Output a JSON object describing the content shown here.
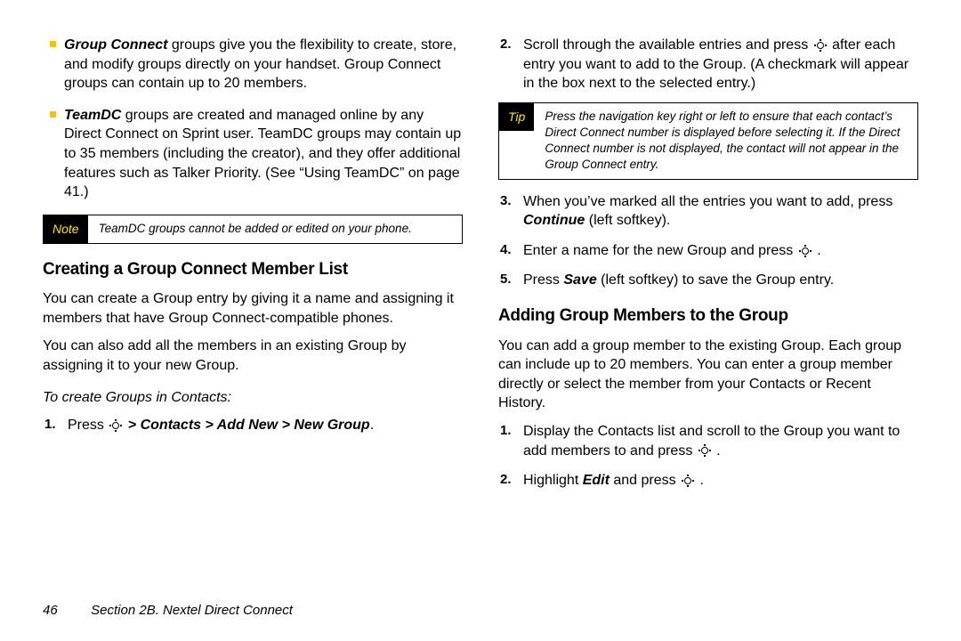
{
  "left": {
    "bullets": [
      {
        "lead": "Group Connect",
        "rest": " groups give you the flexibility to create, store, and modify groups directly on your handset. Group Connect groups can contain up to 20 members."
      },
      {
        "lead": "TeamDC",
        "rest": " groups are created and managed online by any Direct Connect on Sprint user. TeamDC groups may contain up to 35 members (including the creator), and they offer additional features such as Talker Priority. (See “Using TeamDC” on page 41.)"
      }
    ],
    "note": {
      "tag": "Note",
      "body": "TeamDC groups cannot be added or edited on your phone."
    },
    "h_creating": "Creating a Group Connect Member List",
    "p_creating_1": "You can create a Group entry by giving it a name and assigning it members that have Group Connect-compatible phones.",
    "p_creating_2": "You can also add all the members in an existing Group by assigning it to your new Group.",
    "sub_create": "To create Groups in Contacts:",
    "step1_pre": "Press ",
    "step1_post_bi": " > Contacts > Add New > New Group",
    "step1_period": "."
  },
  "right": {
    "step2_pre": "Scroll through the available entries and press ",
    "step2_post": " after each entry you want to add to the Group. (A checkmark will appear in the box next to the selected entry.)",
    "tip": {
      "tag": "Tip",
      "body": "Press the navigation key right or left to ensure that each contact’s Direct Connect number is displayed before selecting it. If the Direct Connect number is not displayed, the contact will not appear in the Group Connect entry."
    },
    "step3_a": "When you’ve marked all the entries you want to add, press ",
    "step3_b": "Continue",
    "step3_c": " (left softkey).",
    "step4_a": "Enter a name for the new Group and press ",
    "step4_b": ".",
    "step5_a": "Press ",
    "step5_b": "Save",
    "step5_c": " (left softkey) to save the Group entry.",
    "h_adding": "Adding Group Members to the Group",
    "p_adding": "You can add a group member to the existing Group. Each group can include up to 20 members. You can enter a group member directly or select the member from your Contacts or Recent History.",
    "add_step1_a": "Display the Contacts list and scroll to the Group you want to add members to and press ",
    "add_step1_b": ".",
    "add_step2_a": "Highlight ",
    "add_step2_b": "Edit",
    "add_step2_c": " and press ",
    "add_step2_d": "."
  },
  "footer": {
    "page": "46",
    "section": "Section 2B. Nextel Direct Connect"
  }
}
